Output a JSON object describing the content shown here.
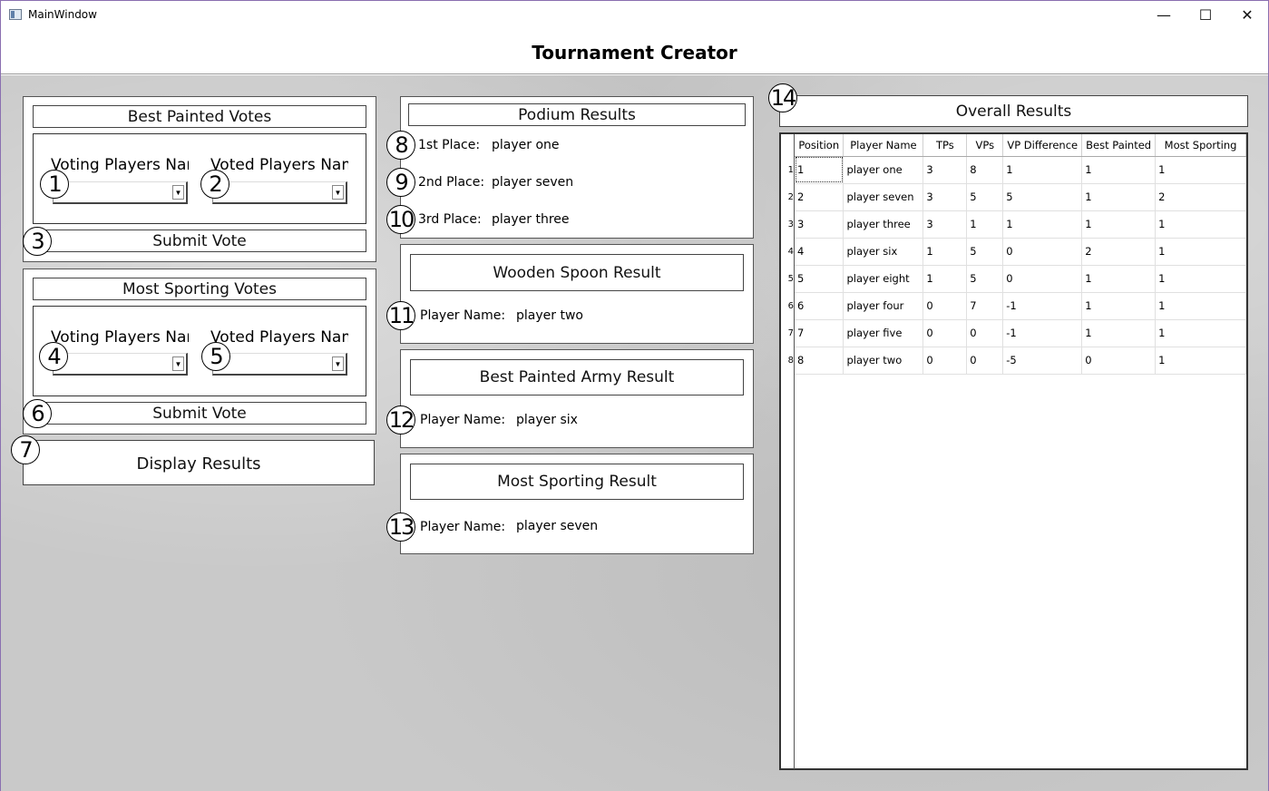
{
  "window": {
    "title": "MainWindow",
    "minimize": "—",
    "maximize": "☐",
    "close": "✕"
  },
  "app": {
    "title": "Tournament Creator"
  },
  "best_painted": {
    "header": "Best Painted Votes",
    "voting_label": "Voting Players Name",
    "voted_label": "Voted Players Name",
    "submit": "Submit Vote"
  },
  "most_sporting": {
    "header": "Most Sporting Votes",
    "voting_label": "Voting Players Name",
    "voted_label": "Voted Players Name",
    "submit": "Submit Vote"
  },
  "display_results": "Display Results",
  "markers": [
    "1",
    "2",
    "3",
    "4",
    "5",
    "6",
    "7",
    "8",
    "9",
    "10",
    "11",
    "12",
    "13",
    "14"
  ],
  "podium": {
    "header": "Podium Results",
    "first_label": "1st Place:",
    "first_value": "player one",
    "second_label": "2nd Place:",
    "second_value": "player seven",
    "third_label": "3rd Place:",
    "third_value": "player three"
  },
  "wooden_spoon": {
    "header": "Wooden Spoon Result",
    "label": "Player Name:",
    "value": "player two"
  },
  "best_army": {
    "header": "Best Painted Army Result",
    "label": "Player Name:",
    "value": "player six"
  },
  "sporting_result": {
    "header": "Most Sporting Result",
    "label": "Player Name:",
    "value": "player seven"
  },
  "overall": {
    "header": "Overall Results",
    "columns": [
      "Position",
      "Player Name",
      "TPs",
      "VPs",
      "VP Difference",
      "Best Painted",
      "Most Sporting"
    ],
    "row_numbers": [
      "1",
      "2",
      "3",
      "4",
      "5",
      "6",
      "7",
      "8"
    ],
    "rows": [
      [
        "1",
        "player one",
        "3",
        "8",
        "1",
        "1",
        "1"
      ],
      [
        "2",
        "player seven",
        "3",
        "5",
        "5",
        "1",
        "2"
      ],
      [
        "3",
        "player three",
        "3",
        "1",
        "1",
        "1",
        "1"
      ],
      [
        "4",
        "player six",
        "1",
        "5",
        "0",
        "2",
        "1"
      ],
      [
        "5",
        "player eight",
        "1",
        "5",
        "0",
        "1",
        "1"
      ],
      [
        "6",
        "player four",
        "0",
        "7",
        "-1",
        "1",
        "1"
      ],
      [
        "7",
        "player five",
        "0",
        "0",
        "-1",
        "1",
        "1"
      ],
      [
        "8",
        "player two",
        "0",
        "0",
        "-5",
        "0",
        "1"
      ]
    ]
  }
}
